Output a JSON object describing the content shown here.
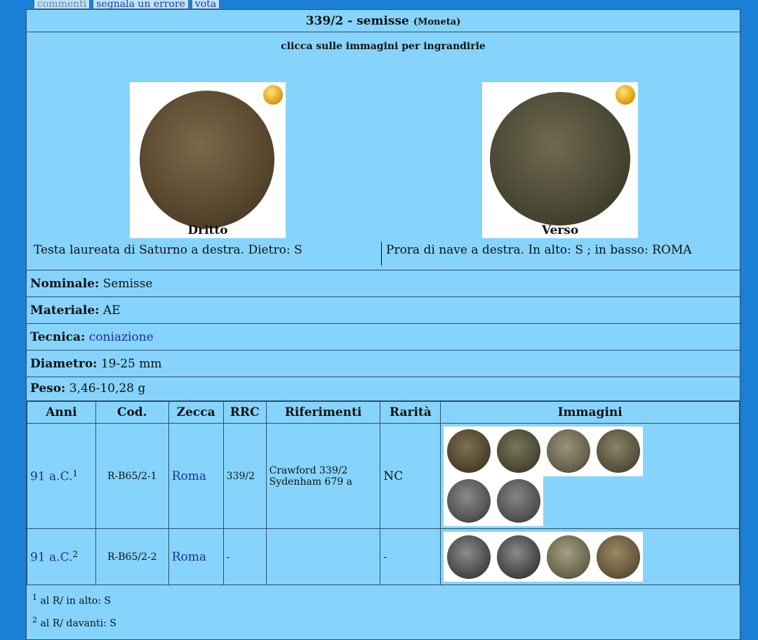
{
  "tabs": [
    "commenti",
    "segnala un errore",
    "vota"
  ],
  "title": {
    "main": "339/2 - semisse",
    "type": "(Moneta)"
  },
  "hint": "clicca sulle immagini per ingrandirle",
  "obverse": {
    "caption": "Dritto",
    "description": "Testa laureata di Saturno a destra. Dietro: S"
  },
  "reverse": {
    "caption": "Verso",
    "description": "Prora di nave a destra. In alto: S ; in basso: ROMA"
  },
  "props": {
    "nominale": {
      "label": "Nominale:",
      "value": "Semisse"
    },
    "materiale": {
      "label": "Materiale:",
      "value": "AE"
    },
    "tecnica": {
      "label": "Tecnica:",
      "value": "coniazione"
    },
    "diametro": {
      "label": "Diametro:",
      "value": "19-25 mm"
    },
    "peso": {
      "label": "Peso:",
      "value": "3,46-10,28 g"
    }
  },
  "table": {
    "headers": [
      "Anni",
      "Cod.",
      "Zecca",
      "RRC",
      "Riferimenti",
      "Rarità",
      "Immagini"
    ],
    "rows": [
      {
        "anni": "91 a.C.",
        "note": "1",
        "cod": "R-B65/2-1",
        "zecca": "Roma",
        "rrc": "339/2",
        "rif1": "Crawford 339/2",
        "rif2": "Sydenham 679 a",
        "rarita": "NC"
      },
      {
        "anni": "91 a.C.",
        "note": "2",
        "cod": "R-B65/2-2",
        "zecca": "Roma",
        "rrc": "-",
        "rif1": "",
        "rif2": "",
        "rarita": "-"
      }
    ]
  },
  "notes": [
    {
      "num": "1",
      "text": "al R/ in alto: S"
    },
    {
      "num": "2",
      "text": "al R/ davanti: S"
    }
  ],
  "colors": {
    "page_bg": "#1a7fd6",
    "panel_bg": "#86d4fb",
    "link": "#1b2fa0",
    "coin_bronze": "#5b4a30"
  }
}
